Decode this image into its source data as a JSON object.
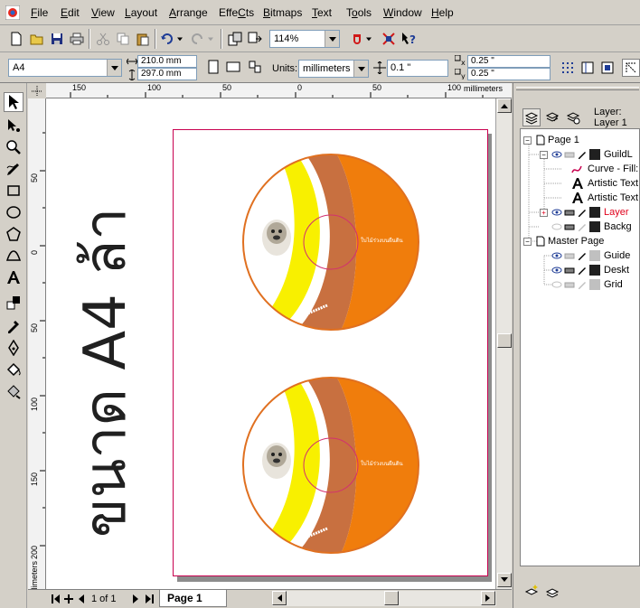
{
  "menu": {
    "items": [
      {
        "label": "File",
        "accel": "F",
        "rest": "ile"
      },
      {
        "label": "Edit",
        "accel": "E",
        "rest": "dit"
      },
      {
        "label": "View",
        "accel": "V",
        "rest": "iew"
      },
      {
        "label": "Layout",
        "accel": "L",
        "rest": "ayout"
      },
      {
        "label": "Arrange",
        "accel": "A",
        "rest": "rrange"
      },
      {
        "label": "Effects",
        "accel": "C",
        "rest": "Effe",
        "tail": "ts"
      },
      {
        "label": "Bitmaps",
        "accel": "B",
        "rest": "itmaps"
      },
      {
        "label": "Text",
        "accel": "T",
        "rest": "ext"
      },
      {
        "label": "Tools",
        "accel": "o",
        "rest": "T",
        "tail": "ols"
      },
      {
        "label": "Window",
        "accel": "W",
        "rest": "indow"
      },
      {
        "label": "Help",
        "accel": "H",
        "rest": "elp"
      }
    ]
  },
  "toolbar": {
    "zoom": "114%"
  },
  "property_bar": {
    "paper_size": "A4",
    "width": "210.0 mm",
    "height": "297.0 mm",
    "units_label": "Units:",
    "units_value": "millimeters",
    "nudge": "0.1 \"",
    "dup_x": "0.25 \"",
    "dup_y": "0.25 \""
  },
  "rulers": {
    "h_unit": "millimeters",
    "v_unit": "millimeters",
    "h_ticks": [
      "150",
      "100",
      "50",
      "0",
      "50",
      "100"
    ],
    "v_ticks": [
      "50",
      "0",
      "50",
      "100",
      "150",
      "200"
    ]
  },
  "canvas": {
    "title_text": "ขนาด A4 ล้า",
    "cd_label": "ใบไม้ร่วงบนผืนดิน"
  },
  "status": {
    "page_count": "1 of 1",
    "page_tab": "Page 1"
  },
  "docker": {
    "layer_label": "Layer:",
    "layer_name": "Layer 1",
    "tree": [
      {
        "label": "Page 1"
      },
      {
        "label": "GuildL"
      },
      {
        "label": "Curve - Fill:"
      },
      {
        "label": "Artistic Text"
      },
      {
        "label": "Artistic Text"
      },
      {
        "label": "Layer"
      },
      {
        "label": "Backg"
      },
      {
        "label": "Master Page"
      },
      {
        "label": "Guide"
      },
      {
        "label": "Deskt"
      },
      {
        "label": "Grid"
      }
    ]
  },
  "colors": {
    "accent_orange": "#f07d0c",
    "cd_yellow": "#f8f000",
    "cd_brown": "#c87040",
    "page_border": "#c8004f",
    "active_layer": "#e0001b"
  }
}
